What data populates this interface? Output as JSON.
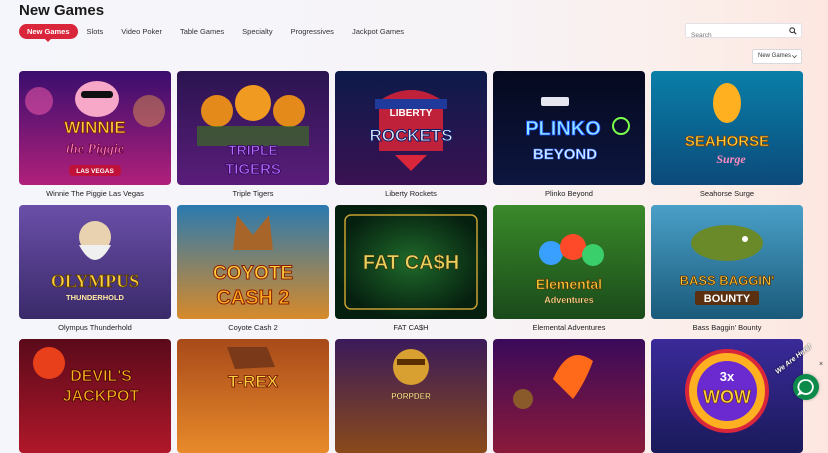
{
  "page": {
    "title": "New Games"
  },
  "tabs": [
    {
      "label": "New Games",
      "active": true
    },
    {
      "label": "Slots"
    },
    {
      "label": "Video Poker"
    },
    {
      "label": "Table Games"
    },
    {
      "label": "Specialty"
    },
    {
      "label": "Progressives"
    },
    {
      "label": "Jackpot Games"
    }
  ],
  "search": {
    "placeholder": "Search",
    "icon": "search-icon"
  },
  "sort": {
    "selected": "New Games"
  },
  "colors": {
    "accent": "#d9263b",
    "chat": "#0b8a4a"
  },
  "games": [
    {
      "name": "Winnie The Piggie Las Vegas",
      "art": [
        "WINNIE",
        "the Piggie",
        "LAS VEGAS"
      ]
    },
    {
      "name": "Triple Tigers",
      "art": [
        "TRIPLE",
        "TIGERS"
      ]
    },
    {
      "name": "Liberty Rockets",
      "art": [
        "LIBERTY",
        "ROCKETS"
      ]
    },
    {
      "name": "Plinko Beyond",
      "art": [
        "PLINKO",
        "BEYOND"
      ]
    },
    {
      "name": "Seahorse Surge",
      "art": [
        "SEAHORSE",
        "Surge"
      ]
    },
    {
      "name": "Olympus Thunderhold",
      "art": [
        "OLYMPUS",
        "THUNDERHOLD"
      ]
    },
    {
      "name": "Coyote Cash 2",
      "art": [
        "COYOTE",
        "CASH 2"
      ]
    },
    {
      "name": "FAT CA$H",
      "art": [
        "FAT CA$H"
      ]
    },
    {
      "name": "Elemental Adventures",
      "art": [
        "Elemental",
        "Adventures"
      ]
    },
    {
      "name": "Bass Baggin' Bounty",
      "art": [
        "BASS BAGGIN'",
        "BOUNTY"
      ]
    },
    {
      "name": "",
      "art": [
        "DEVIL'S",
        "JACKPOT"
      ]
    },
    {
      "name": "",
      "art": [
        "T-REX"
      ]
    },
    {
      "name": "",
      "art": [
        "PORPDER"
      ]
    },
    {
      "name": "",
      "art": []
    },
    {
      "name": "",
      "art": [
        "3x",
        "WOW"
      ]
    }
  ],
  "chat": {
    "label": "We Are Here!"
  }
}
